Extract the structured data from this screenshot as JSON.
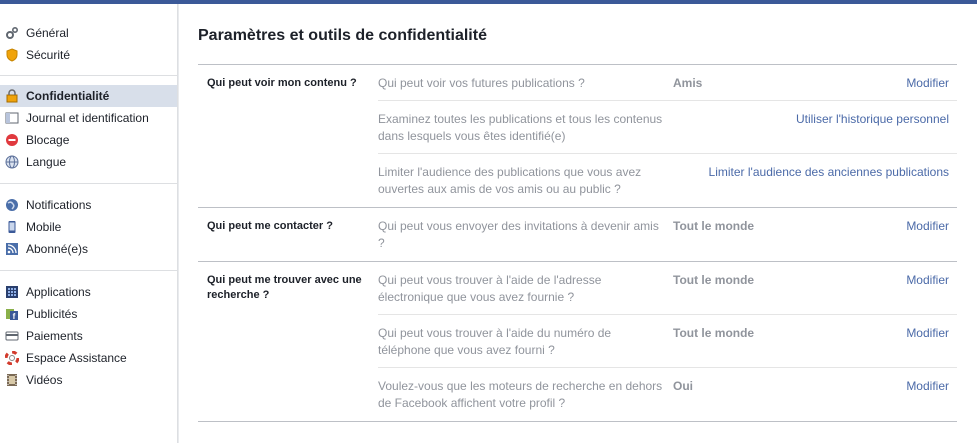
{
  "sidebar": {
    "groups": [
      [
        {
          "label": "Général",
          "icon": "gears-icon"
        },
        {
          "label": "Sécurité",
          "icon": "shield-icon"
        }
      ],
      [
        {
          "label": "Confidentialité",
          "icon": "lock-icon",
          "active": true
        },
        {
          "label": "Journal et identification",
          "icon": "timeline-icon"
        },
        {
          "label": "Blocage",
          "icon": "block-icon"
        },
        {
          "label": "Langue",
          "icon": "globe-icon"
        }
      ],
      [
        {
          "label": "Notifications",
          "icon": "globe-notif-icon"
        },
        {
          "label": "Mobile",
          "icon": "mobile-icon"
        },
        {
          "label": "Abonné(e)s",
          "icon": "rss-icon"
        }
      ],
      [
        {
          "label": "Applications",
          "icon": "apps-icon"
        },
        {
          "label": "Publicités",
          "icon": "ads-icon"
        },
        {
          "label": "Paiements",
          "icon": "card-icon"
        },
        {
          "label": "Espace Assistance",
          "icon": "lifebuoy-icon"
        },
        {
          "label": "Vidéos",
          "icon": "film-icon"
        }
      ]
    ]
  },
  "main": {
    "title": "Paramètres et outils de confidentialité",
    "sections": [
      {
        "label": "Qui peut voir mon contenu ?",
        "rows": [
          {
            "question": "Qui peut voir vos futures publications ?",
            "value": "Amis",
            "action": "Modifier"
          },
          {
            "question": "Examinez toutes les publications et tous les contenus dans lesquels vous êtes identifié(e)",
            "value": "",
            "action": "Utiliser l'historique personnel"
          },
          {
            "question": "Limiter l'audience des publications que vous avez ouvertes aux amis de vos amis ou au public ?",
            "value": "",
            "action": "Limiter l'audience des anciennes publications"
          }
        ]
      },
      {
        "label": "Qui peut me contacter ?",
        "rows": [
          {
            "question": "Qui peut vous envoyer des invitations à devenir amis ?",
            "value": "Tout le monde",
            "action": "Modifier"
          }
        ]
      },
      {
        "label": "Qui peut me trouver avec une recherche ?",
        "rows": [
          {
            "question": "Qui peut vous trouver à l'aide de l'adresse électronique que vous avez fournie ?",
            "value": "Tout le monde",
            "action": "Modifier"
          },
          {
            "question": "Qui peut vous trouver à l'aide du numéro de téléphone que vous avez fourni ?",
            "value": "Tout le monde",
            "action": "Modifier"
          },
          {
            "question": "Voulez-vous que les moteurs de recherche en dehors de Facebook affichent votre profil ?",
            "value": "Oui",
            "action": "Modifier"
          }
        ]
      }
    ]
  }
}
